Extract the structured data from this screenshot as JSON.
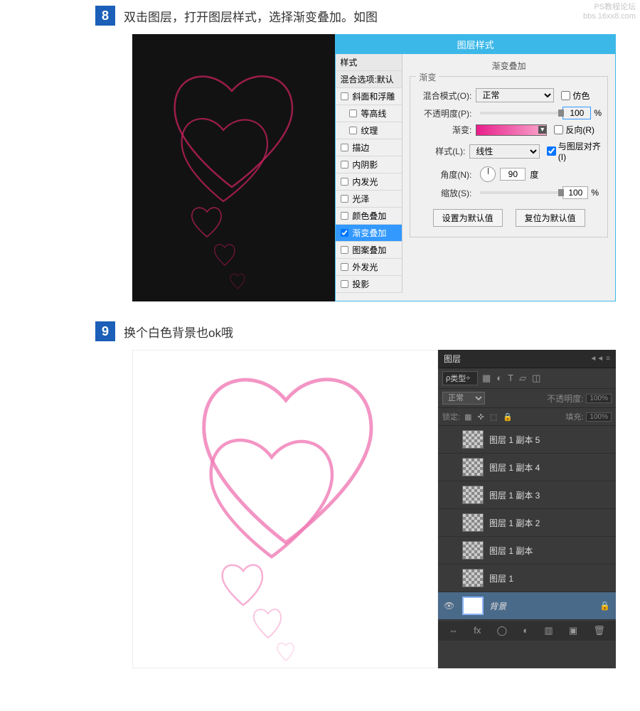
{
  "watermark": {
    "l1": "PS教程论坛",
    "l2": "bbs.16xx8.com"
  },
  "step8": {
    "num": "8",
    "text": "双击图层，打开图层样式，选择渐变叠加。如图"
  },
  "step9": {
    "num": "9",
    "text": "换个白色背景也ok哦"
  },
  "dialog": {
    "title": "图层样式",
    "styles_header": "样式",
    "blend_default": "混合选项:默认",
    "items": {
      "bevel": "斜面和浮雕",
      "contour": "等高线",
      "texture": "纹理",
      "stroke": "描边",
      "innershadow": "内阴影",
      "innerglow": "内发光",
      "satin": "光泽",
      "coloroverlay": "颜色叠加",
      "gradientoverlay": "渐变叠加",
      "patternoverlay": "图案叠加",
      "outerglow": "外发光",
      "dropshadow": "投影"
    },
    "opt_title": "渐变叠加",
    "legend": "渐变",
    "blendmode_label": "混合模式(O):",
    "blendmode_value": "正常",
    "dither_label": "仿色",
    "opacity_label": "不透明度(P):",
    "opacity_value": "100",
    "pct": "%",
    "gradient_label": "渐变:",
    "reverse_label": "反向(R)",
    "style_label": "样式(L):",
    "style_value": "线性",
    "align_label": "与图层对齐(I)",
    "angle_label": "角度(N):",
    "angle_value": "90",
    "deg": "度",
    "scale_label": "缩放(S):",
    "scale_value": "100",
    "btn_default": "设置为默认值",
    "btn_reset": "复位为默认值"
  },
  "layers": {
    "tab": "图层",
    "type": "类型",
    "mode": "正常",
    "opacity_label": "不透明度:",
    "opacity_val": "100%",
    "lock_label": "锁定:",
    "fill_label": "填充:",
    "fill_val": "100%",
    "items": [
      "图层 1 副本 5",
      "图层 1 副本 4",
      "图层 1 副本 3",
      "图层 1 副本 2",
      "图层 1 副本",
      "图层 1",
      "背景"
    ]
  }
}
